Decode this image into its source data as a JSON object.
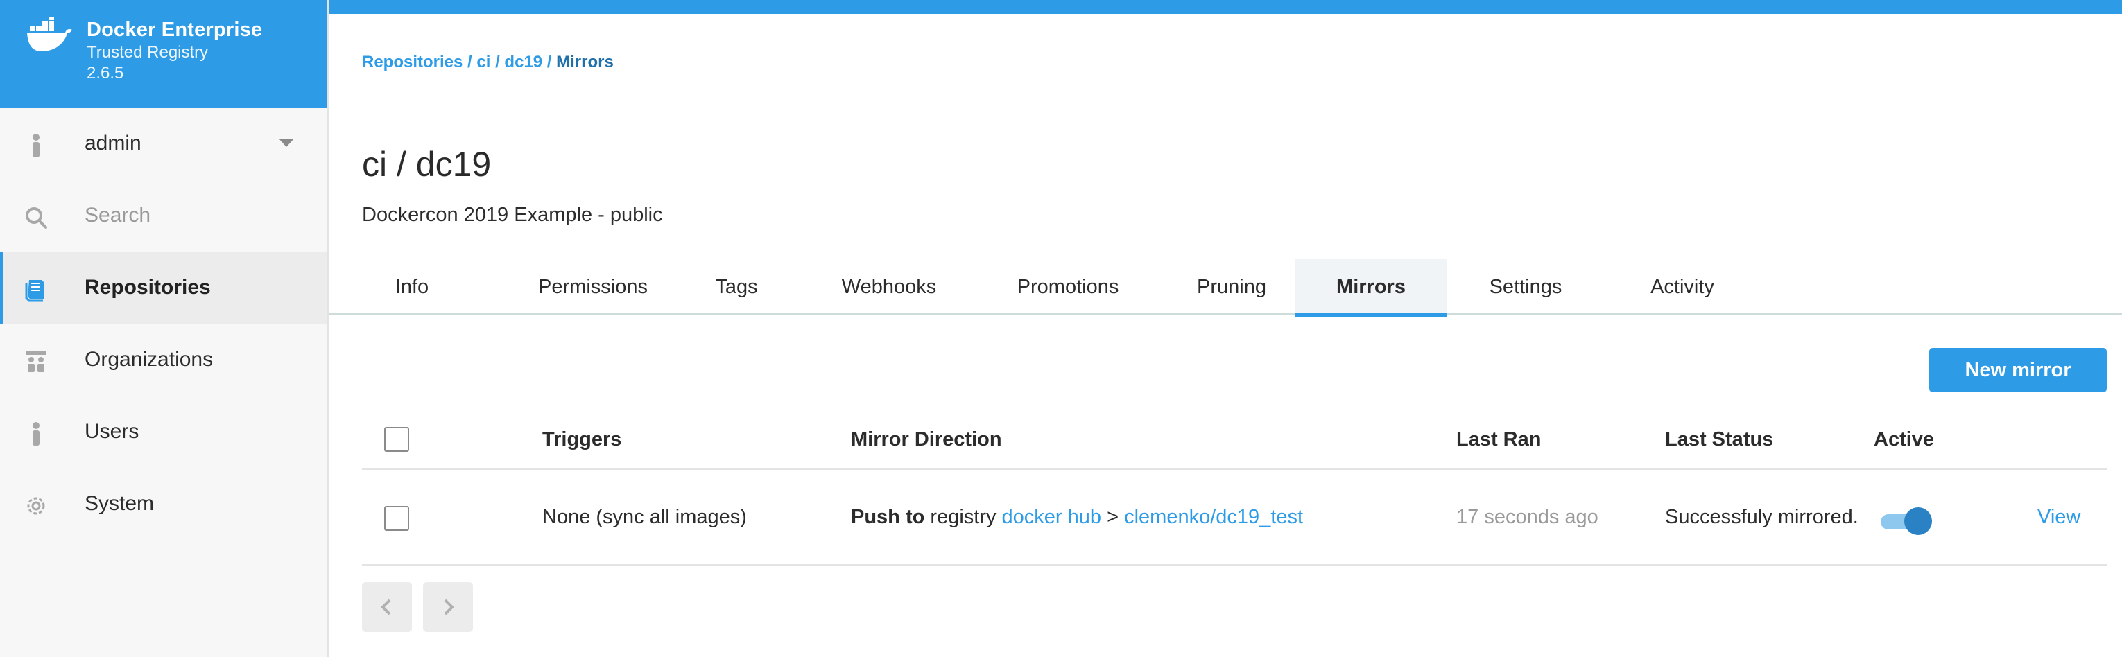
{
  "brand": {
    "title": "Docker Enterprise",
    "subtitle": "Trusted Registry",
    "version": "2.6.5",
    "logo_icon": "docker-whale-icon",
    "bar_color": "#2d9be5"
  },
  "sidebar": {
    "user": {
      "label": "admin",
      "icon": "user-icon"
    },
    "search": {
      "placeholder": "Search",
      "icon": "search-icon"
    },
    "items": [
      {
        "label": "Repositories",
        "icon": "repositories-icon",
        "active": true
      },
      {
        "label": "Organizations",
        "icon": "organizations-icon",
        "active": false
      },
      {
        "label": "Users",
        "icon": "user-icon",
        "active": false
      },
      {
        "label": "System",
        "icon": "gear-icon",
        "active": false
      }
    ]
  },
  "breadcrumb": {
    "part1": "Repositories",
    "sep1": " / ",
    "part2": "ci",
    "sep2": " / ",
    "part3": "dc19",
    "sep3": " / ",
    "current": "Mirrors"
  },
  "repo": {
    "title": "ci / dc19",
    "description": "Dockercon 2019 Example - public"
  },
  "tabs": [
    {
      "label": "Info"
    },
    {
      "label": "Permissions"
    },
    {
      "label": "Tags"
    },
    {
      "label": "Webhooks"
    },
    {
      "label": "Promotions"
    },
    {
      "label": "Pruning"
    },
    {
      "label": "Mirrors",
      "active": true
    },
    {
      "label": "Settings"
    },
    {
      "label": "Activity"
    }
  ],
  "actions": {
    "new_mirror": "New mirror"
  },
  "table": {
    "headers": {
      "triggers": "Triggers",
      "direction": "Mirror Direction",
      "last_ran": "Last Ran",
      "last_status": "Last Status",
      "active": "Active"
    },
    "rows": [
      {
        "triggers": "None (sync all images)",
        "direction_verb": "Push to",
        "direction_word": "registry",
        "registry_link": "docker hub",
        "arrow": ">",
        "repo_link": "clemenko/dc19_test",
        "last_ran": "17 seconds ago",
        "last_status": "Successfuly mirrored.",
        "active": true,
        "view": "View"
      }
    ]
  },
  "pagination": {
    "prev_icon": "chevron-left-icon",
    "next_icon": "chevron-right-icon"
  }
}
